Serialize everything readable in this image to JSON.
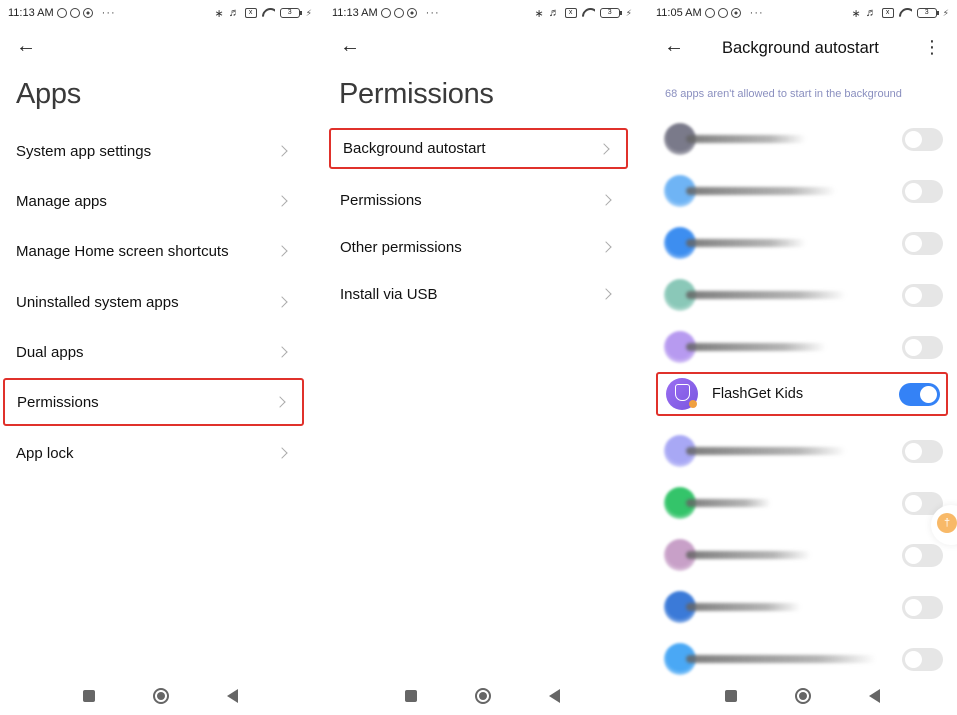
{
  "screens": [
    {
      "status": {
        "time": "11:13 AM",
        "more": "···",
        "battery": "3"
      },
      "title": "Apps",
      "items": [
        {
          "label": "System app settings"
        },
        {
          "label": "Manage apps"
        },
        {
          "label": "Manage Home screen shortcuts"
        },
        {
          "label": "Uninstalled system apps"
        },
        {
          "label": "Dual apps"
        },
        {
          "label": "Permissions",
          "highlighted": true
        },
        {
          "label": "App lock"
        }
      ]
    },
    {
      "status": {
        "time": "11:13 AM",
        "more": "···",
        "battery": "3"
      },
      "title": "Permissions",
      "items": [
        {
          "label": "Background autostart",
          "highlighted": true
        },
        {
          "label": "Permissions"
        },
        {
          "label": "Other permissions"
        },
        {
          "label": "Install via USB"
        }
      ]
    },
    {
      "status": {
        "time": "11:05 AM",
        "more": "···",
        "battery": "3"
      },
      "title": "Background autostart",
      "subtitle": "68 apps aren't allowed to start in the background",
      "apps": [
        {
          "name": "(blurred)",
          "enabled": false,
          "icon_color": "#7a7a8a"
        },
        {
          "name": "(blurred)",
          "enabled": false,
          "icon_color": "#6fb4f5"
        },
        {
          "name": "(blurred)",
          "enabled": false,
          "icon_color": "#3d8ef0"
        },
        {
          "name": "(blurred)",
          "enabled": false,
          "icon_color": "#8ac8b8"
        },
        {
          "name": "(blurred)",
          "enabled": false,
          "icon_color": "#b79af0"
        },
        {
          "name": "FlashGet Kids",
          "enabled": true,
          "highlighted": true,
          "icon_color": "#8b62ea"
        },
        {
          "name": "(blurred)",
          "enabled": false,
          "icon_color": "#a8a8f5"
        },
        {
          "name": "(blurred)",
          "enabled": false,
          "icon_color": "#34c46a"
        },
        {
          "name": "(blurred)",
          "enabled": false,
          "icon_color": "#c8a0c8"
        },
        {
          "name": "(blurred)",
          "enabled": false,
          "icon_color": "#3b7ad8"
        },
        {
          "name": "(blurred)",
          "enabled": false,
          "icon_color": "#4aa8f5"
        }
      ]
    }
  ],
  "colors": {
    "highlight": "#e0312b",
    "toggle_on": "#3482f6",
    "toggle_off": "#e6e6e6",
    "subtitle": "#8a8fbf"
  },
  "icons": {
    "back": "←",
    "more": "⋮",
    "bluetooth": "✱",
    "bolt": "ϟ"
  }
}
